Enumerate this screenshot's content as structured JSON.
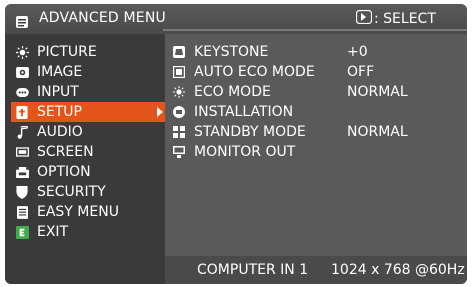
{
  "header": {
    "menu_title": "ADVANCED MENU",
    "select_hint": ": SELECT"
  },
  "left_menu": {
    "items": [
      {
        "label": "PICTURE",
        "icon": "sun-icon"
      },
      {
        "label": "IMAGE",
        "icon": "image-icon"
      },
      {
        "label": "INPUT",
        "icon": "input-icon"
      },
      {
        "label": "SETUP",
        "icon": "setup-icon",
        "active": true
      },
      {
        "label": "AUDIO",
        "icon": "music-note-icon"
      },
      {
        "label": "SCREEN",
        "icon": "screen-icon"
      },
      {
        "label": "OPTION",
        "icon": "option-icon"
      },
      {
        "label": "SECURITY",
        "icon": "shield-icon"
      },
      {
        "label": "EASY MENU",
        "icon": "easy-menu-icon"
      },
      {
        "label": "EXIT",
        "icon": "exit-icon"
      }
    ]
  },
  "submenu": {
    "items": [
      {
        "label": "KEYSTONE",
        "value": "+0",
        "icon": "keystone-icon"
      },
      {
        "label": "AUTO ECO MODE",
        "value": "OFF",
        "icon": "auto-eco-icon"
      },
      {
        "label": "ECO MODE",
        "value": "NORMAL",
        "icon": "eco-lamp-icon"
      },
      {
        "label": "INSTALLATION",
        "value": "",
        "icon": "installation-icon"
      },
      {
        "label": "STANDBY MODE",
        "value": "NORMAL",
        "icon": "standby-icon"
      },
      {
        "label": "MONITOR OUT",
        "value": "",
        "icon": "monitor-out-icon"
      }
    ]
  },
  "status": {
    "source": "COMPUTER IN 1",
    "resolution": "1024 x 768 @60Hz"
  },
  "colors": {
    "highlight": "#e5541a",
    "panel_dark": "#3a3a3a",
    "panel_light": "#5a5a5a"
  }
}
